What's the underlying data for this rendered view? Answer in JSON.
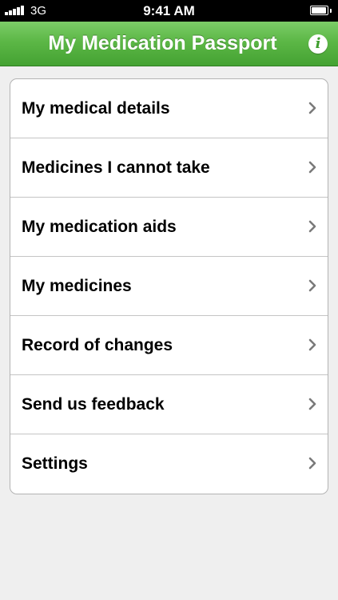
{
  "status_bar": {
    "network": "3G",
    "time": "9:41 AM"
  },
  "nav": {
    "title": "My Medication Passport",
    "info_icon": "info-icon",
    "accent_color": "#5cb746"
  },
  "menu": {
    "items": [
      {
        "label": "My medical details"
      },
      {
        "label": "Medicines I cannot take"
      },
      {
        "label": "My medication aids"
      },
      {
        "label": "My medicines"
      },
      {
        "label": "Record of changes"
      },
      {
        "label": "Send us feedback"
      },
      {
        "label": "Settings"
      }
    ]
  }
}
